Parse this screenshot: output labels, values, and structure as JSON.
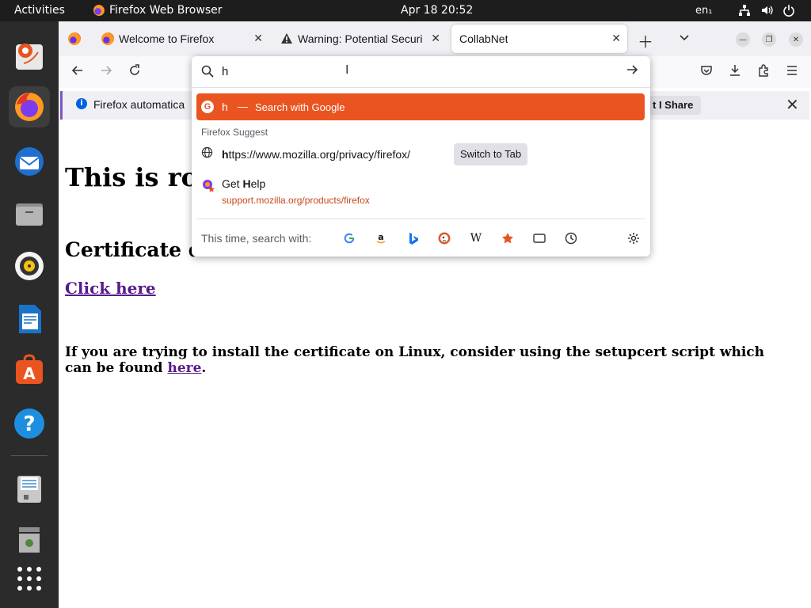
{
  "topbar": {
    "activities": "Activities",
    "app_name": "Firefox Web Browser",
    "clock": "Apr 18  20:52",
    "language": "en₁"
  },
  "tabs": [
    {
      "label": "Welcome to Firefox",
      "selected": false
    },
    {
      "label": "Warning: Potential Securi",
      "selected": false
    },
    {
      "label": "CollabNet",
      "selected": true
    }
  ],
  "notification": {
    "text": "Firefox automatica",
    "button": "t I Share"
  },
  "page": {
    "heading": "This is ro",
    "subheading": "Certificate d",
    "link": "Click here",
    "note_prefix": "If you are trying to install the certificate on Linux, consider using the setupcert script which can be found ",
    "note_link": "here",
    "note_suffix": "."
  },
  "urlbar": {
    "value": "h",
    "suggestions": {
      "search": {
        "query": "h",
        "separator": "—",
        "action": "Search with Google"
      },
      "section_label": "Firefox Suggest",
      "url_row": {
        "match": "h",
        "rest": "ttps://www.mozilla.org/privacy/firefox/",
        "button": "Switch to Tab"
      },
      "help_row": {
        "title_pre": "Get ",
        "title_match": "H",
        "title_post": "elp",
        "url": "support.mozilla.org/products/firefox"
      }
    },
    "one_off_label": "This time, search with:",
    "engines": [
      "google-icon",
      "amazon-icon",
      "bing-icon",
      "duckduckgo-icon",
      "wikipedia-icon",
      "bookmarks-icon",
      "tabs-icon",
      "history-icon"
    ]
  },
  "colors": {
    "ubuntu_orange": "#e95420",
    "dock_bg": "#2b2b2b",
    "topbar_bg": "#1d1d1d"
  }
}
